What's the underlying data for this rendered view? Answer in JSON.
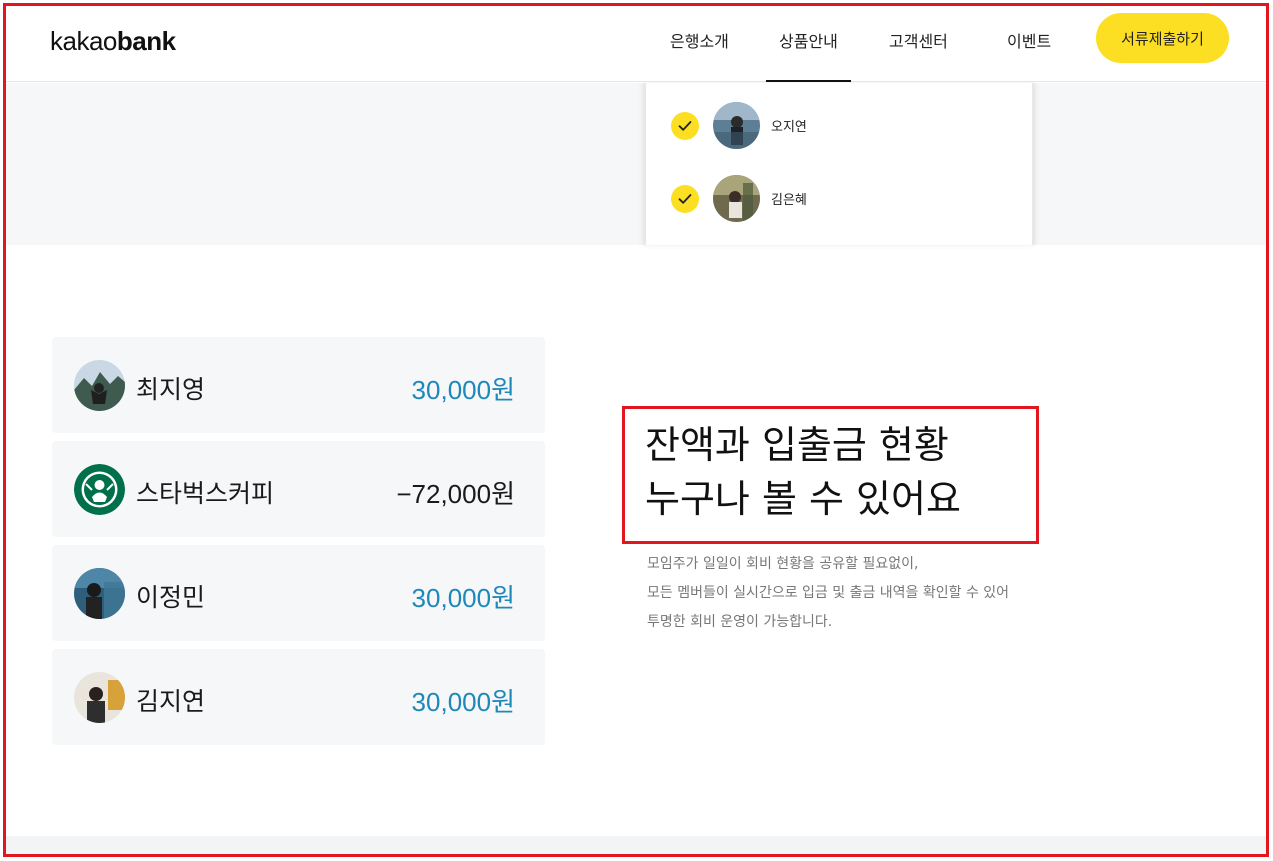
{
  "header": {
    "logo_light": "kakao",
    "logo_bold": "bank",
    "nav": [
      {
        "label": "은행소개"
      },
      {
        "label": "상품안내"
      },
      {
        "label": "고객센터"
      },
      {
        "label": "이벤트"
      }
    ],
    "cta_label": "서류제출하기"
  },
  "members_card": [
    {
      "name": "오지연",
      "checked": true
    },
    {
      "name": "김은혜",
      "checked": true
    }
  ],
  "transactions": [
    {
      "name": "최지영",
      "amount": "30,000원",
      "type": "deposit"
    },
    {
      "name": "스타벅스커피",
      "amount": "−72,000원",
      "type": "withdrawal"
    },
    {
      "name": "이정민",
      "amount": "30,000원",
      "type": "deposit"
    },
    {
      "name": "김지연",
      "amount": "30,000원",
      "type": "deposit"
    }
  ],
  "feature": {
    "title_line1": "잔액과 입출금 현황",
    "title_line2": "누구나 볼 수 있어요",
    "desc_line1": "모임주가 일일이 회비 현황을 공유할 필요없이,",
    "desc_line2": "모든 멤버들이 실시간으로 입금 및 출금 내역을 확인할 수 있어",
    "desc_line3": "투명한 회비 운영이 가능합니다."
  },
  "colors": {
    "brand_yellow": "#fcdf22",
    "deposit_blue": "#1e88b8",
    "highlight_red": "#e3151e"
  }
}
